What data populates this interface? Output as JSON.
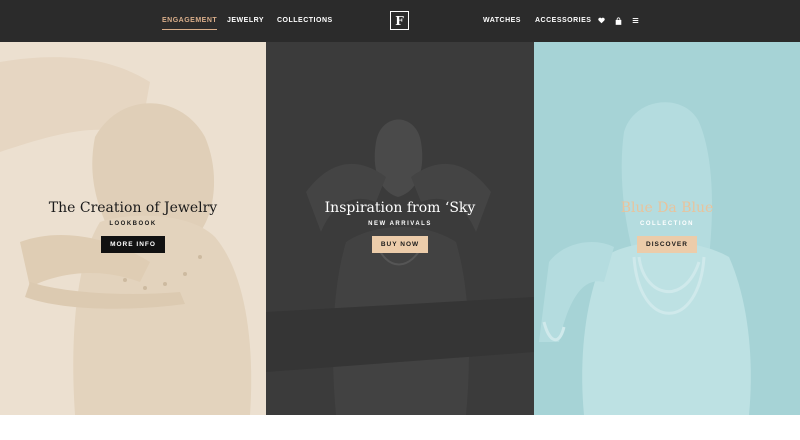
{
  "nav": {
    "left_items": [
      {
        "label": "Engagement",
        "active": true
      },
      {
        "label": "Jewelry",
        "active": false
      },
      {
        "label": "Collections",
        "active": false
      }
    ],
    "logo_letter": "F",
    "right_items": [
      {
        "label": "Watches"
      },
      {
        "label": "Accessories"
      }
    ],
    "icons": [
      "heart-icon",
      "bag-icon",
      "menu-icon"
    ],
    "accent_color": "#d9ae8a",
    "bar_color": "#2b2b2b"
  },
  "panels": [
    {
      "title": "The Creation of Jewelry",
      "subtitle": "Lookbook",
      "button": "More Info",
      "bg_color": "#ece0d0"
    },
    {
      "title": "Inspiration from ‘Sky",
      "subtitle": "New Arrivals",
      "button": "Buy Now",
      "bg_color": "#3b3b3b"
    },
    {
      "title": "Blue Da Blue",
      "subtitle": "Collection",
      "button": "Discover",
      "bg_color": "#a6d3d6"
    }
  ]
}
